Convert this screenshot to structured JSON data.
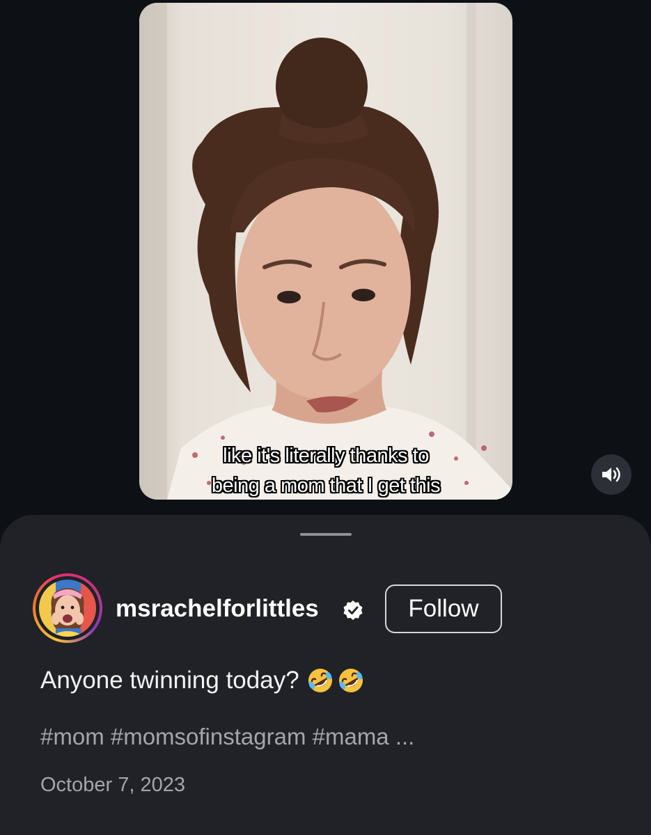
{
  "video": {
    "caption_line1": "like it's literally thanks to",
    "caption_line2": "being a mom that I get this",
    "sound_icon": "volume-icon"
  },
  "post": {
    "username": "msrachelforlittles",
    "verified": true,
    "follow_label": "Follow",
    "caption": "Anyone twinning today?",
    "emojis": [
      "rolling-on-floor-laughing-icon",
      "rolling-on-floor-laughing-icon"
    ],
    "hashtags": "#mom #momsofinstagram #mama ...",
    "date": "October 7, 2023"
  },
  "colors": {
    "background": "#0d1015",
    "sheet": "#202227",
    "secondary_text": "#a3a6ab"
  }
}
